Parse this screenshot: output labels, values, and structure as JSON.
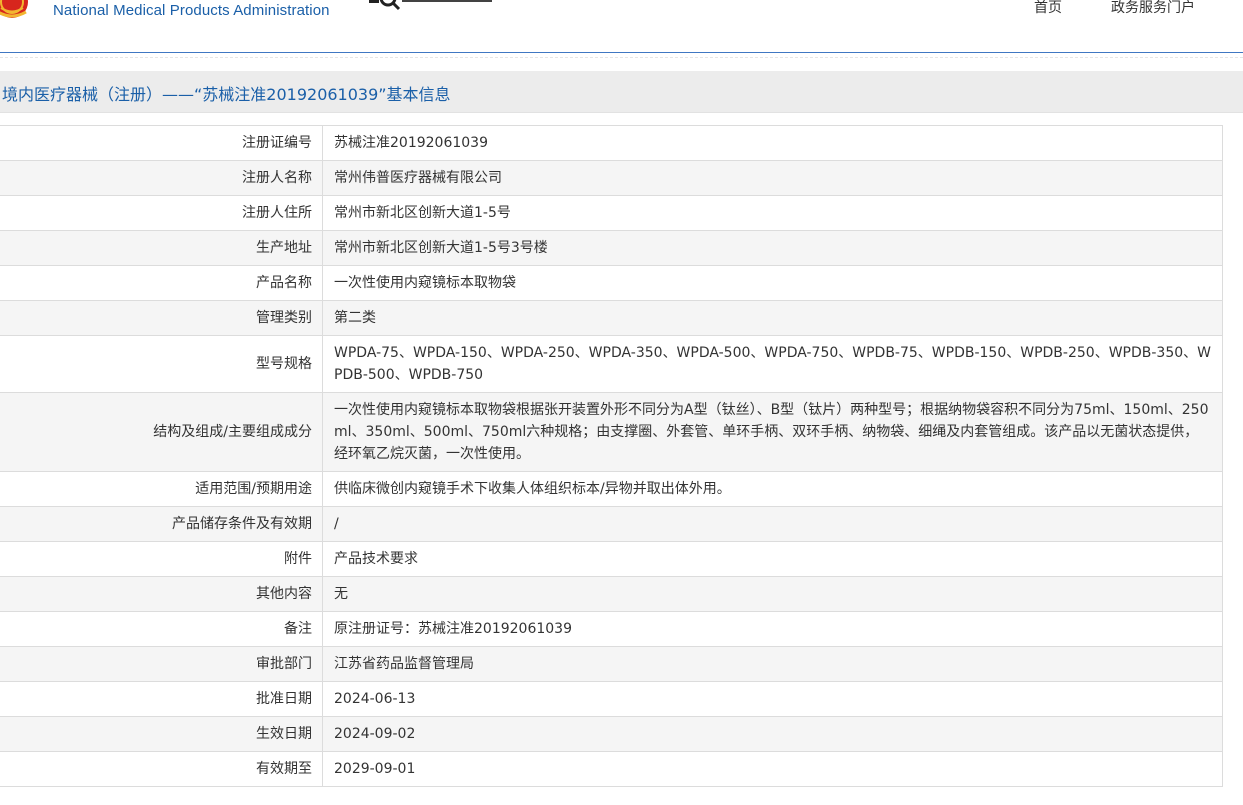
{
  "header": {
    "org_name_en": "National Medical Products Administration",
    "nav": [
      {
        "label": "首页"
      },
      {
        "label": "政务服务门户"
      }
    ]
  },
  "title": "境内医疗器械（注册）——“苏械注准20192061039”基本信息",
  "rows": [
    {
      "label": "注册证编号",
      "value": "苏械注准20192061039"
    },
    {
      "label": "注册人名称",
      "value": "常州伟普医疗器械有限公司"
    },
    {
      "label": "注册人住所",
      "value": "常州市新北区创新大道1-5号"
    },
    {
      "label": "生产地址",
      "value": "常州市新北区创新大道1-5号3号楼"
    },
    {
      "label": "产品名称",
      "value": "一次性使用内窥镜标本取物袋"
    },
    {
      "label": "管理类别",
      "value": "第二类"
    },
    {
      "label": "型号规格",
      "value": "WPDA-75、WPDA-150、WPDA-250、WPDA-350、WPDA-500、WPDA-750、WPDB-75、WPDB-150、WPDB-250、WPDB-350、WPDB-500、WPDB-750"
    },
    {
      "label": "结构及组成/主要组成成分",
      "value": "一次性使用内窥镜标本取物袋根据张开装置外形不同分为A型（钛丝）、B型（钛片）两种型号；根据纳物袋容积不同分为75ml、150ml、250ml、350ml、500ml、750ml六种规格；由支撑圈、外套管、单环手柄、双环手柄、纳物袋、细绳及内套管组成。该产品以无菌状态提供，经环氧乙烷灭菌，一次性使用。"
    },
    {
      "label": "适用范围/预期用途",
      "value": "供临床微创内窥镜手术下收集人体组织标本/异物并取出体外用。"
    },
    {
      "label": "产品储存条件及有效期",
      "value": "/"
    },
    {
      "label": "附件",
      "value": "产品技术要求"
    },
    {
      "label": "其他内容",
      "value": "无"
    },
    {
      "label": "备注",
      "value": "原注册证号：苏械注准20192061039"
    },
    {
      "label": "审批部门",
      "value": "江苏省药品监督管理局"
    },
    {
      "label": "批准日期",
      "value": "2024-06-13"
    },
    {
      "label": "生效日期",
      "value": "2024-09-02"
    },
    {
      "label": "有效期至",
      "value": "2029-09-01"
    }
  ],
  "colors": {
    "brand_blue": "#1a5fa8",
    "emblem_red": "#d7261d",
    "emblem_gold": "#f2b630",
    "row_alt": "#f5f5f5",
    "title_bar": "#ececec"
  },
  "icons": {
    "emblem": "nmpa-emblem-icon",
    "data_logo": "data-query-logo-icon"
  }
}
